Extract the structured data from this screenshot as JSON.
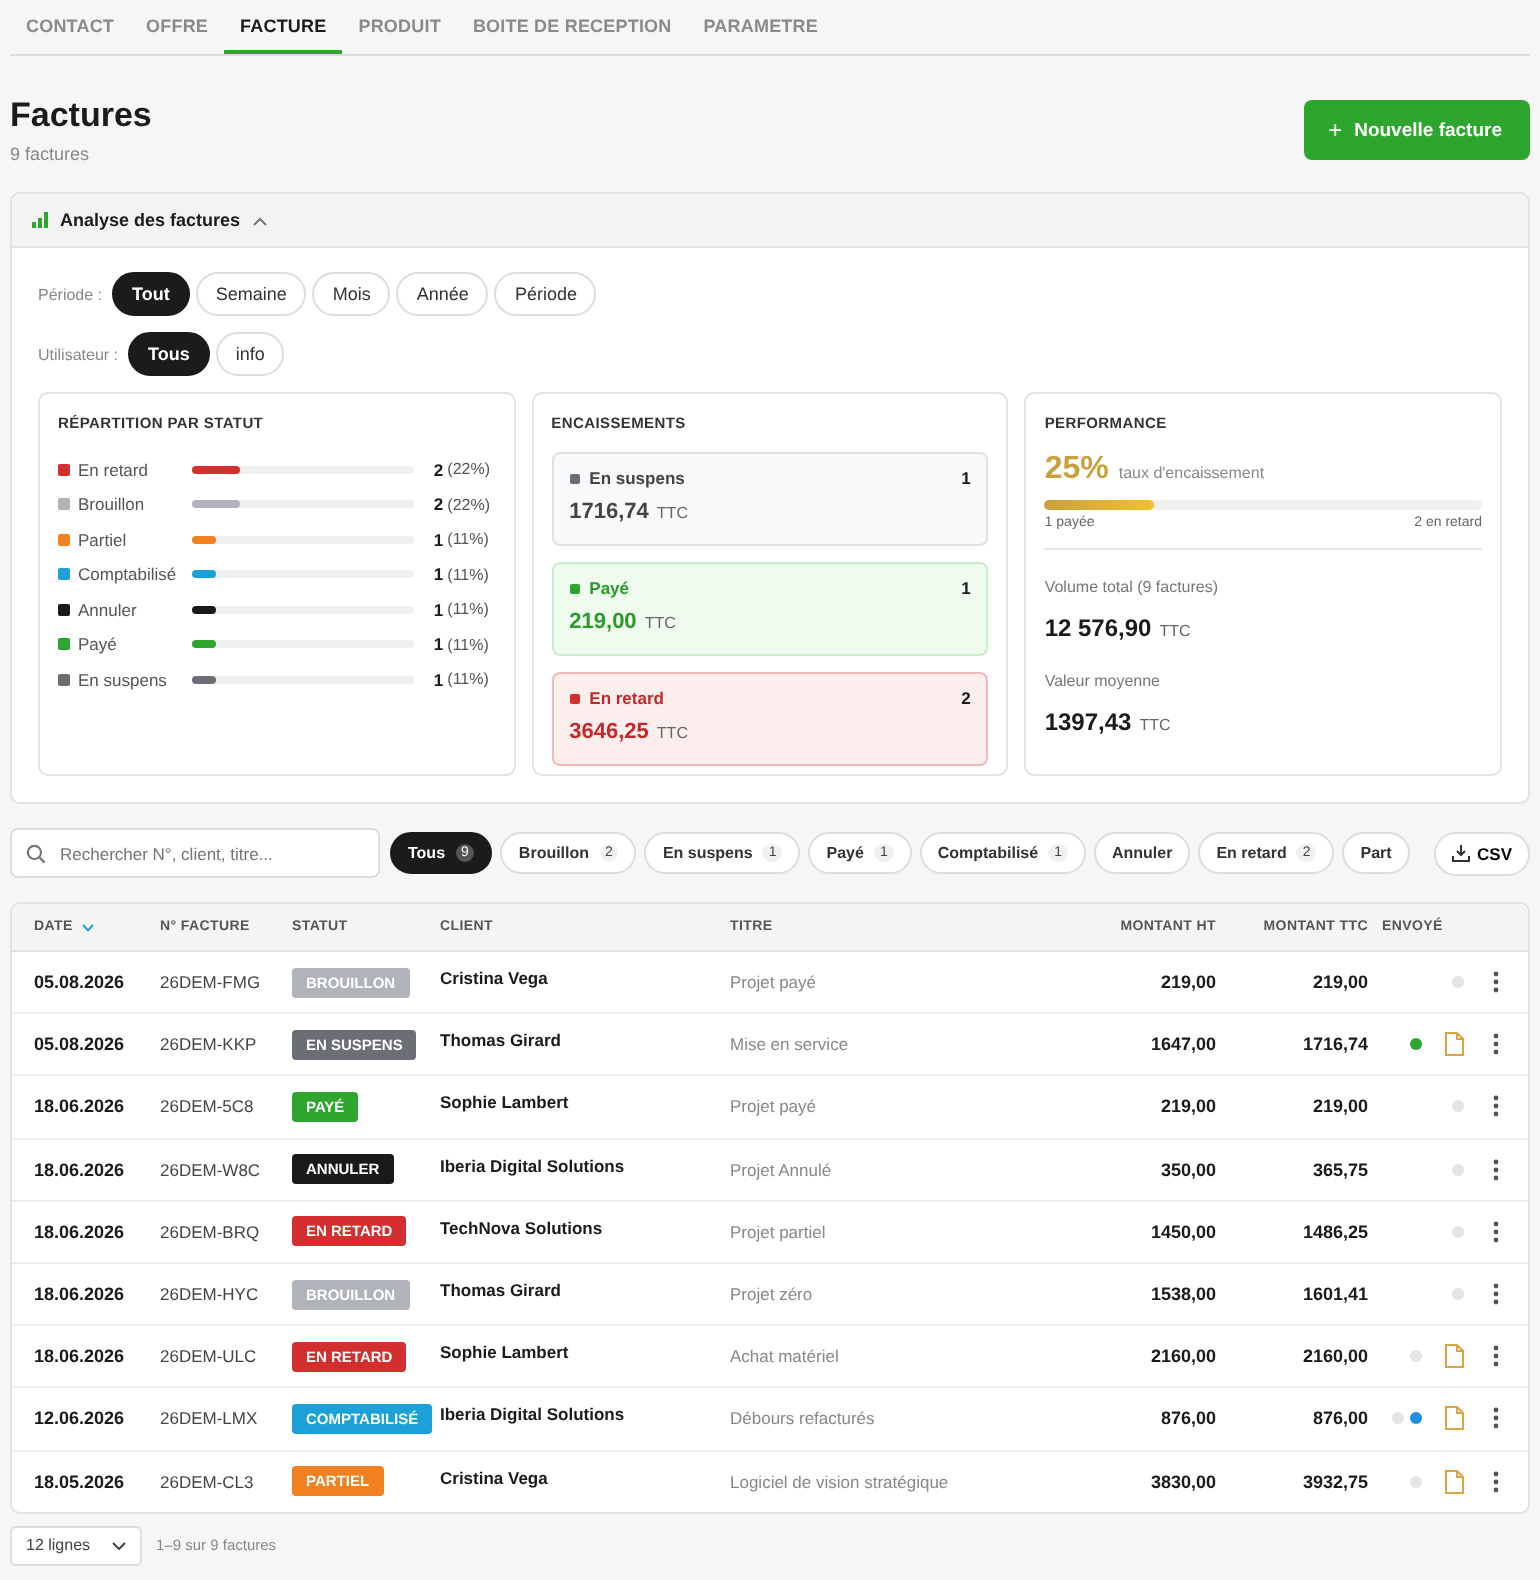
{
  "tabs": [
    {
      "label": "CONTACT",
      "selected": false
    },
    {
      "label": "OFFRE",
      "selected": false
    },
    {
      "label": "FACTURE",
      "selected": true
    },
    {
      "label": "PRODUIT",
      "selected": false
    },
    {
      "label": "BOITE DE RECEPTION",
      "selected": false
    },
    {
      "label": "PARAMETRE",
      "selected": false
    }
  ],
  "header": {
    "title": "Factures",
    "subtitle": "9 factures",
    "new_button": "Nouvelle facture",
    "new_icon": "+"
  },
  "analysis": {
    "title": "Analyse des factures",
    "expanded": true,
    "filters": [
      {
        "label": "Période :",
        "options": [
          {
            "label": "Tout",
            "selected": true
          },
          {
            "label": "Semaine",
            "selected": false
          },
          {
            "label": "Mois",
            "selected": false
          },
          {
            "label": "Année",
            "selected": false
          },
          {
            "label": "Période",
            "selected": false
          }
        ]
      },
      {
        "label": "Utilisateur :",
        "options": [
          {
            "label": "Tous",
            "selected": true
          },
          {
            "label": "info",
            "selected": false
          }
        ]
      }
    ],
    "distribution": {
      "title": "RÉPARTITION PAR STATUT",
      "items": [
        {
          "label": "En retard",
          "color": "#d32f2f",
          "level": 0.22,
          "count": "2",
          "share": "(22%)"
        },
        {
          "label": "Brouillon",
          "color": "#b0b3ba",
          "level": 0.22,
          "count": "2",
          "share": "(22%)"
        },
        {
          "label": "Partiel",
          "color": "#f08020",
          "level": 0.11,
          "count": "1",
          "share": "(11%)"
        },
        {
          "label": "Comptabilisé",
          "color": "#1ba0d8",
          "level": 0.11,
          "count": "1",
          "share": "(11%)"
        },
        {
          "label": "Annuler",
          "color": "#1a1a1a",
          "level": 0.11,
          "count": "1",
          "share": "(11%)"
        },
        {
          "label": "Payé",
          "color": "#2ea52e",
          "level": 0.11,
          "count": "1",
          "share": "(11%)"
        },
        {
          "label": "En suspens",
          "color": "#6b6e75",
          "level": 0.11,
          "count": "1",
          "share": "(11%)"
        }
      ]
    },
    "collections": {
      "title": "ENCAISSEMENTS",
      "items": [
        {
          "kind": "pending",
          "label": "En suspens",
          "count": "1",
          "amount": "1716,74",
          "unit": "TTC"
        },
        {
          "kind": "paid",
          "label": "Payé",
          "count": "1",
          "amount": "219,00",
          "unit": "TTC"
        },
        {
          "kind": "late",
          "label": "En retard",
          "count": "2",
          "amount": "3646,25",
          "unit": "TTC"
        }
      ]
    },
    "performance": {
      "title": "PERFORMANCE",
      "rate": "25%",
      "rate_label": "taux d'encaissement",
      "level": 0.25,
      "left_note": "1 payée",
      "right_note": "2 en retard",
      "stats": [
        {
          "label": "Volume total (9 factures)",
          "value": "12 576,90",
          "unit": "TTC"
        },
        {
          "label": "Valeur moyenne",
          "value": "1397,43",
          "unit": "TTC"
        }
      ]
    }
  },
  "toolbar": {
    "search_placeholder": "Rechercher N°, client, titre...",
    "chips": [
      {
        "label": "Tous",
        "count": "9",
        "selected": true
      },
      {
        "label": "Brouillon",
        "count": "2",
        "selected": false
      },
      {
        "label": "En suspens",
        "count": "1",
        "selected": false
      },
      {
        "label": "Payé",
        "count": "1",
        "selected": false
      },
      {
        "label": "Comptabilisé",
        "count": "1",
        "selected": false
      },
      {
        "label": "Annuler",
        "selected": false
      },
      {
        "label": "En retard",
        "count": "2",
        "selected": false
      },
      {
        "label": "Part",
        "selected": false
      }
    ],
    "export_button": "CSV"
  },
  "table": {
    "columns": [
      {
        "label": "DATE",
        "sorted": true
      },
      {
        "label": "N° FACTURE",
        "sorted": false
      },
      {
        "label": "STATUT",
        "sorted": false
      },
      {
        "label": "CLIENT",
        "sorted": false
      },
      {
        "label": "TITRE",
        "sorted": false
      },
      {
        "label": "MONTANT HT",
        "sorted": false
      },
      {
        "label": "MONTANT TTC",
        "sorted": false
      },
      {
        "label": "ENVOYÉ",
        "sorted": false
      }
    ],
    "rows": [
      {
        "date": "05.08.2026",
        "number": "26DEM-FMG",
        "status": {
          "label": "BROUILLON",
          "color": "#b0b3ba"
        },
        "client": "Cristina Vega",
        "title": "Projet payé",
        "ht": "219,00",
        "ttc": "219,00",
        "sent": [
          {
            "color": "#e4e4e4"
          }
        ],
        "document": false
      },
      {
        "date": "05.08.2026",
        "number": "26DEM-KKP",
        "status": {
          "label": "EN SUSPENS",
          "color": "#6b6e75"
        },
        "client": "Thomas Girard",
        "title": "Mise en service",
        "ht": "1647,00",
        "ttc": "1716,74",
        "sent": [
          {
            "color": "#2ea52e"
          }
        ],
        "document": true
      },
      {
        "date": "18.06.2026",
        "number": "26DEM-5C8",
        "status": {
          "label": "PAYÉ",
          "color": "#2ea52e"
        },
        "client": "Sophie Lambert",
        "title": "Projet payé",
        "ht": "219,00",
        "ttc": "219,00",
        "sent": [
          {
            "color": "#e4e4e4"
          }
        ],
        "document": false
      },
      {
        "date": "18.06.2026",
        "number": "26DEM-W8C",
        "status": {
          "label": "ANNULER",
          "color": "#1a1a1a"
        },
        "client": "Iberia Digital Solutions",
        "title": "Projet Annulé",
        "ht": "350,00",
        "ttc": "365,75",
        "sent": [
          {
            "color": "#e4e4e4"
          }
        ],
        "document": false
      },
      {
        "date": "18.06.2026",
        "number": "26DEM-BRQ",
        "status": {
          "label": "EN RETARD",
          "color": "#d32f2f"
        },
        "client": "TechNova Solutions",
        "title": "Projet partiel",
        "ht": "1450,00",
        "ttc": "1486,25",
        "sent": [
          {
            "color": "#e4e4e4"
          }
        ],
        "document": false
      },
      {
        "date": "18.06.2026",
        "number": "26DEM-HYC",
        "status": {
          "label": "BROUILLON",
          "color": "#b0b3ba"
        },
        "client": "Thomas Girard",
        "title": "Projet zéro",
        "ht": "1538,00",
        "ttc": "1601,41",
        "sent": [
          {
            "color": "#e4e4e4"
          }
        ],
        "document": false
      },
      {
        "date": "18.06.2026",
        "number": "26DEM-ULC",
        "status": {
          "label": "EN RETARD",
          "color": "#d32f2f"
        },
        "client": "Sophie Lambert",
        "title": "Achat matériel",
        "ht": "2160,00",
        "ttc": "2160,00",
        "sent": [
          {
            "color": "#e4e4e4"
          }
        ],
        "document": true
      },
      {
        "date": "12.06.2026",
        "number": "26DEM-LMX",
        "status": {
          "label": "COMPTABILISÉ",
          "color": "#1ba0d8"
        },
        "client": "Iberia Digital Solutions",
        "title": "Débours refacturés",
        "ht": "876,00",
        "ttc": "876,00",
        "sent": [
          {
            "color": "#e4e4e4"
          },
          {
            "color": "#1b8fe0"
          }
        ],
        "document": true
      },
      {
        "date": "18.05.2026",
        "number": "26DEM-CL3",
        "status": {
          "label": "PARTIEL",
          "color": "#f08020"
        },
        "client": "Cristina Vega",
        "title": "Logiciel de vision stratégique",
        "ht": "3830,00",
        "ttc": "3932,75",
        "sent": [
          {
            "color": "#e4e4e4"
          }
        ],
        "document": true
      }
    ]
  },
  "footer": {
    "page_size": "12 lignes",
    "range": "1–9 sur 9 factures"
  }
}
